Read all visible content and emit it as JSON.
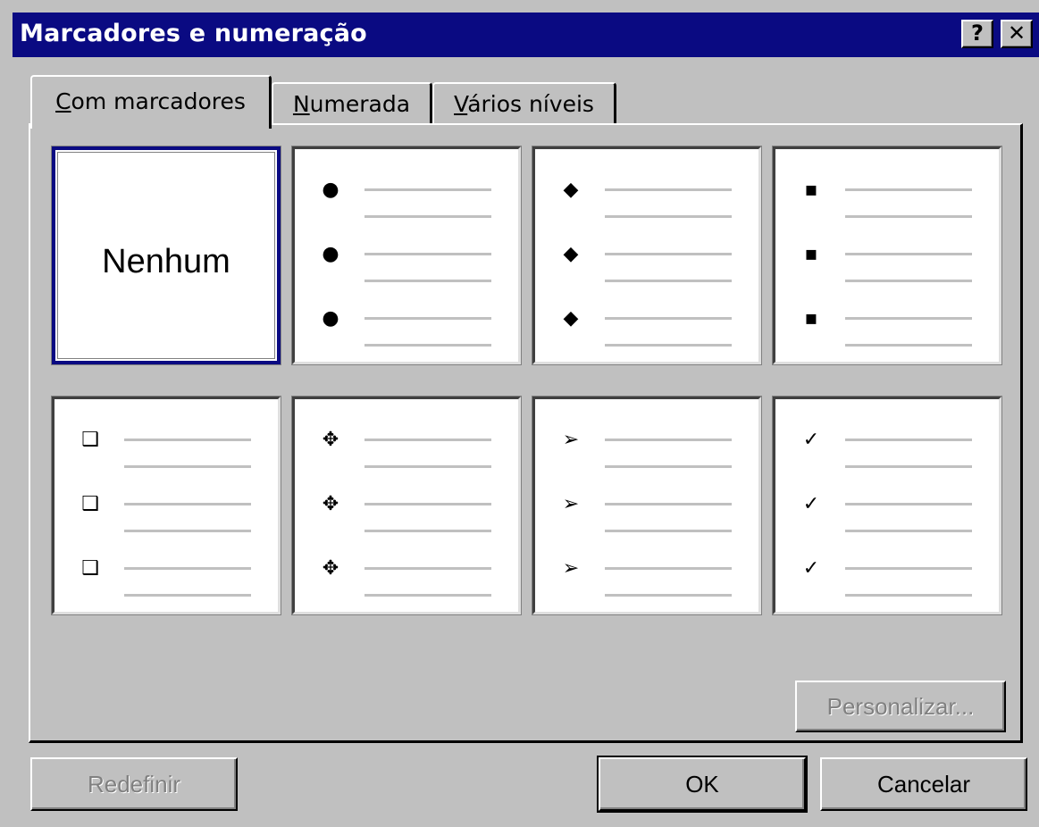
{
  "window": {
    "title": "Marcadores e numeração",
    "help_label": "?",
    "close_label": "✕"
  },
  "tabs": [
    {
      "label": "Com marcadores",
      "active": true,
      "mnemonic": "C",
      "rest": "om marcadores"
    },
    {
      "label": "Numerada",
      "active": false,
      "mnemonic": "N",
      "rest": "umerada"
    },
    {
      "label": "Vários níveis",
      "active": false,
      "mnemonic": "V",
      "rest": "ários níveis"
    }
  ],
  "bullet_options": [
    {
      "label": "Nenhum",
      "glyph": "",
      "icon": "none",
      "selected": true
    },
    {
      "label": "",
      "glyph": "●",
      "icon": "filled-circle-bullet-icon"
    },
    {
      "label": "",
      "glyph": "◆",
      "icon": "filled-diamond-bullet-icon"
    },
    {
      "label": "",
      "glyph": "▪",
      "icon": "filled-square-bullet-icon"
    },
    {
      "label": "",
      "glyph": "❑",
      "icon": "hollow-square-bullet-icon"
    },
    {
      "label": "",
      "glyph": "✥",
      "icon": "four-diamond-bullet-icon"
    },
    {
      "label": "",
      "glyph": "➢",
      "icon": "arrowhead-bullet-icon"
    },
    {
      "label": "",
      "glyph": "✓",
      "icon": "checkmark-bullet-icon"
    }
  ],
  "buttons": {
    "personalizar": "Personalizar...",
    "redefinir": "Redefinir",
    "ok": "OK",
    "cancelar": "Cancelar"
  },
  "colors": {
    "title_bar": "#0a0a82",
    "dialog_face": "#c0c0c0",
    "disabled_text": "#808080"
  }
}
